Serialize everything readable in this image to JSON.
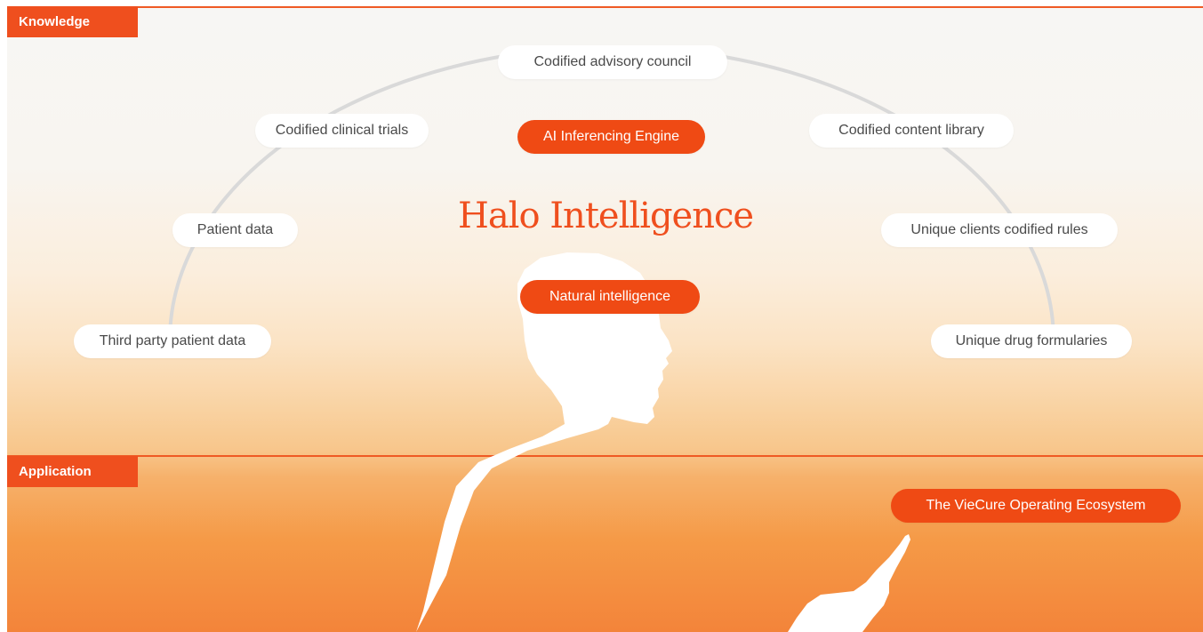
{
  "sections": {
    "knowledge": "Knowledge",
    "application": "Application"
  },
  "title": "Halo Intelligence",
  "knowledge_nodes": {
    "advisory": "Codified advisory council",
    "clinical_trials": "Codified clinical trials",
    "content_library": "Codified content library",
    "patient_data": "Patient data",
    "client_rules": "Unique clients codified rules",
    "third_party": "Third party patient data",
    "formularies": "Unique drug formularies"
  },
  "engines": {
    "ai": "AI Inferencing Engine",
    "natural": "Natural intelligence"
  },
  "application_nodes": {
    "ecosystem": "The VieCure Operating Ecosystem"
  },
  "colors": {
    "accent": "#ef4a14",
    "pill": "#ffffff",
    "arc": "#d9d9d9"
  }
}
